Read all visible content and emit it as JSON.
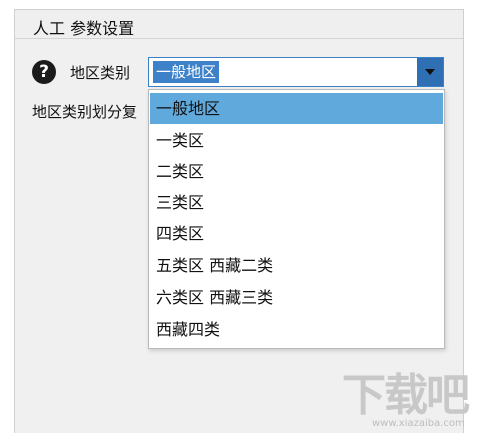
{
  "panel": {
    "title": "人工 参数设置"
  },
  "field": {
    "help_icon_char": "?",
    "label": "地区类别",
    "selected_value": "一般地区",
    "note": "地区类别划分复"
  },
  "dropdown": {
    "options": [
      {
        "label": "一般地区",
        "selected": true
      },
      {
        "label": "一类区"
      },
      {
        "label": "二类区"
      },
      {
        "label": "三类区"
      },
      {
        "label": "四类区"
      },
      {
        "label": "五类区 西藏二类"
      },
      {
        "label": "六类区 西藏三类"
      },
      {
        "label": "西藏四类"
      }
    ]
  },
  "watermark": {
    "text": "下载吧",
    "url": "www.xiazaiba.com"
  },
  "colors": {
    "highlight": "#5fa9dc",
    "select_border": "#3b7fc6",
    "panel_bg": "#f0f0f0"
  }
}
